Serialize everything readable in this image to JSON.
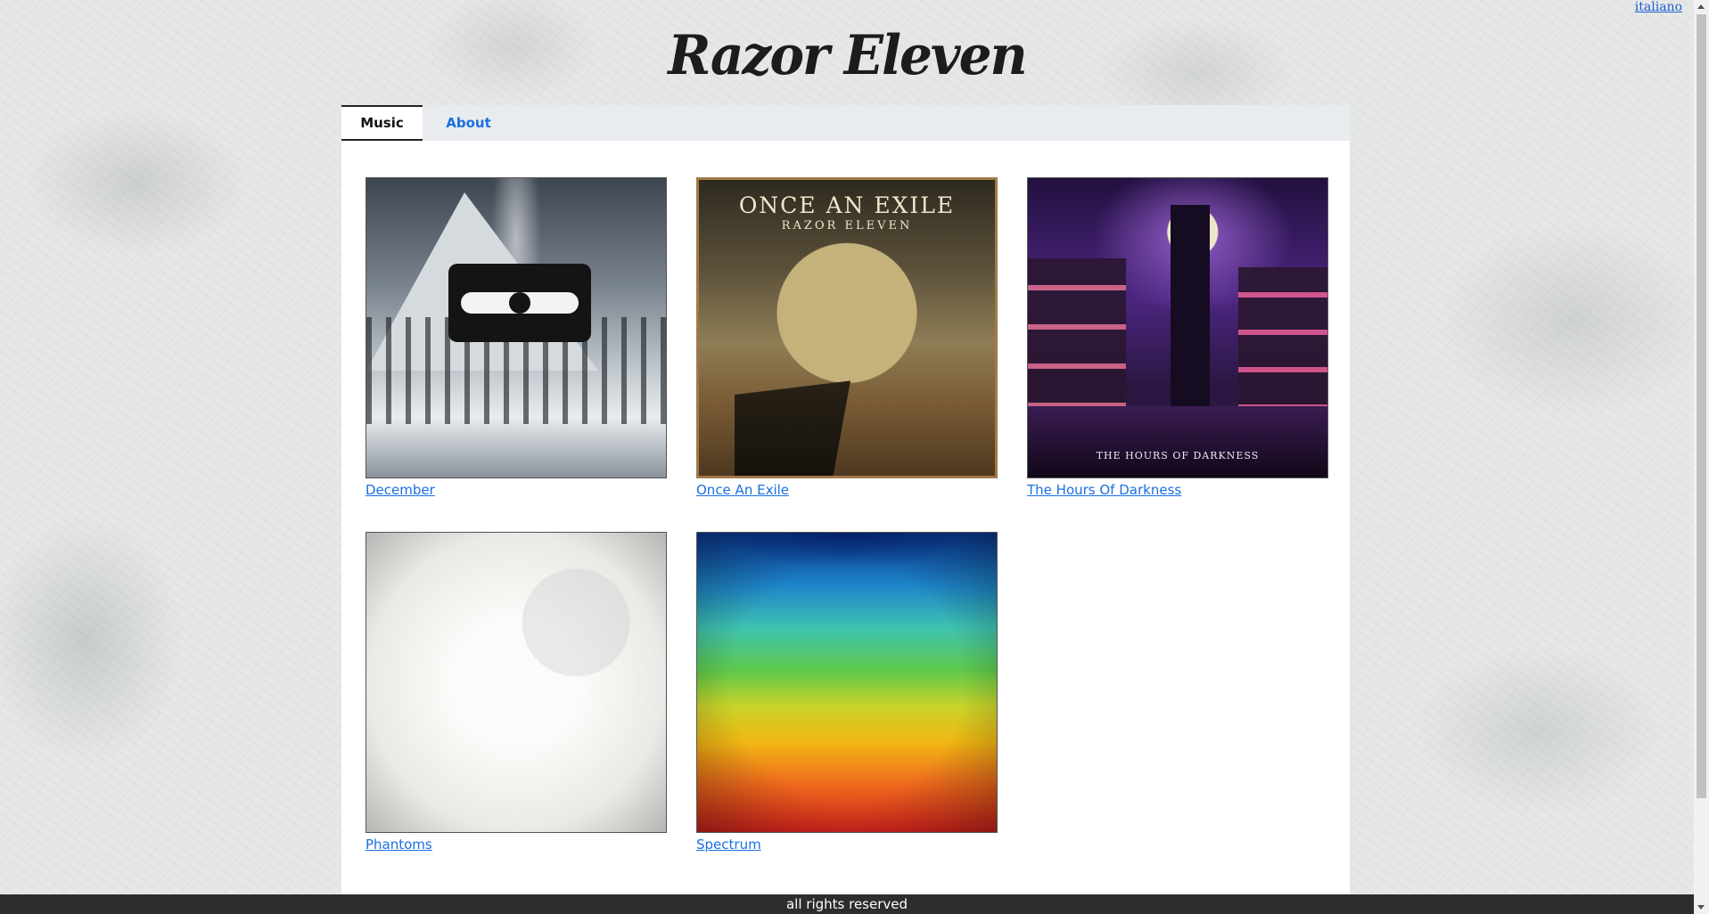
{
  "lang_link": "italiano",
  "site_title": "Razor Eleven",
  "tabs": [
    {
      "label": "Music",
      "active": true
    },
    {
      "label": "About",
      "active": false
    }
  ],
  "albums": [
    {
      "title": "December"
    },
    {
      "title": "Once An Exile",
      "cover_title": "ONCE AN EXILE",
      "cover_subtitle": "RAZOR ELEVEN"
    },
    {
      "title": "The Hours Of Darkness",
      "cover_caption": "THE HOURS OF DARKNESS"
    },
    {
      "title": "Phantoms"
    },
    {
      "title": "Spectrum"
    }
  ],
  "footer": "all rights reserved",
  "colors": {
    "link": "#1a6fe0",
    "footer_bg": "#2d2d2d",
    "tabbar_bg": "#e9ecef"
  }
}
